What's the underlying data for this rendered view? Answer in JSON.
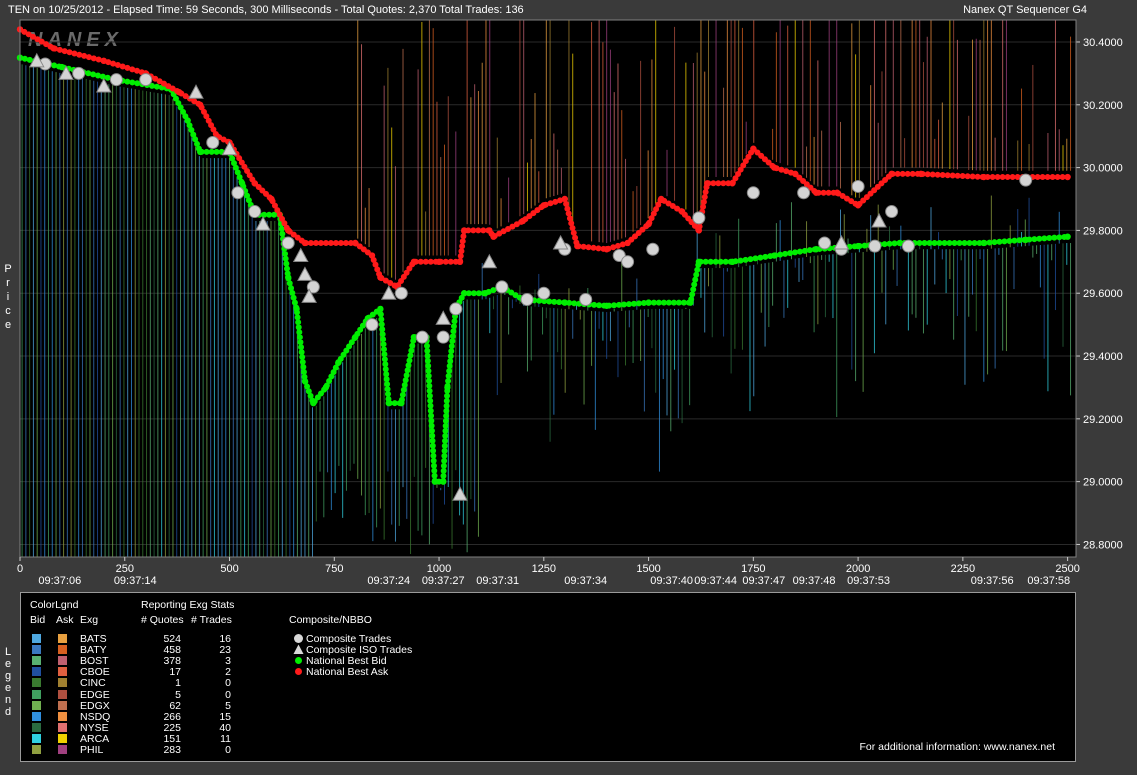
{
  "header": {
    "info": "TEN on 10/25/2012  -  Elapsed Time: 59 Seconds, 300 Milliseconds  -  Total Quotes: 2,370  Total Trades: 136",
    "app": "Nanex QT Sequencer G4",
    "watermark": "NANEX"
  },
  "axis_titles": {
    "price": "Price",
    "legend": "Legend"
  },
  "chart_data": {
    "type": "line",
    "ylabel": "Price",
    "ylim": [
      28.76,
      30.47
    ],
    "xlim": [
      0,
      2520
    ],
    "y_ticks": [
      "30.4000",
      "30.2000",
      "30.0000",
      "29.8000",
      "29.6000",
      "29.4000",
      "29.2000",
      "29.0000",
      "28.8000"
    ],
    "y_tick_values": [
      30.4,
      30.2,
      30.0,
      29.8,
      29.6,
      29.4,
      29.2,
      29.0,
      28.8
    ],
    "x_ticks": [
      {
        "label": "0",
        "value": 0
      },
      {
        "label": "250",
        "value": 250
      },
      {
        "label": "500",
        "value": 500
      },
      {
        "label": "750",
        "value": 750
      },
      {
        "label": "1000",
        "value": 1000
      },
      {
        "label": "1250",
        "value": 1250
      },
      {
        "label": "1500",
        "value": 1500
      },
      {
        "label": "1750",
        "value": 1750
      },
      {
        "label": "2000",
        "value": 2000
      },
      {
        "label": "2250",
        "value": 2250
      },
      {
        "label": "2500",
        "value": 2500
      }
    ],
    "time_labels": [
      {
        "label": "09:37:06",
        "value": 95
      },
      {
        "label": "09:37:14",
        "value": 275
      },
      {
        "label": "09:37:24",
        "value": 880
      },
      {
        "label": "09:37:27",
        "value": 1010
      },
      {
        "label": "09:37:31",
        "value": 1140
      },
      {
        "label": "09:37:34",
        "value": 1350
      },
      {
        "label": "09:37:40",
        "value": 1555
      },
      {
        "label": "09:37:44",
        "value": 1660
      },
      {
        "label": "09:37:47",
        "value": 1775
      },
      {
        "label": "09:37:48",
        "value": 1895
      },
      {
        "label": "09:37:53",
        "value": 2025
      },
      {
        "label": "09:37:56",
        "value": 2320
      },
      {
        "label": "09:37:58",
        "value": 2455
      }
    ],
    "series": [
      {
        "name": "National Best Bid",
        "color": "#00ee00",
        "points": [
          [
            0,
            30.35
          ],
          [
            100,
            30.32
          ],
          [
            230,
            30.28
          ],
          [
            360,
            30.25
          ],
          [
            400,
            30.15
          ],
          [
            430,
            30.05
          ],
          [
            500,
            30.05
          ],
          [
            530,
            29.95
          ],
          [
            560,
            29.85
          ],
          [
            620,
            29.85
          ],
          [
            640,
            29.65
          ],
          [
            660,
            29.55
          ],
          [
            680,
            29.32
          ],
          [
            700,
            29.25
          ],
          [
            730,
            29.3
          ],
          [
            760,
            29.38
          ],
          [
            800,
            29.46
          ],
          [
            830,
            29.52
          ],
          [
            860,
            29.55
          ],
          [
            880,
            29.25
          ],
          [
            910,
            29.25
          ],
          [
            940,
            29.46
          ],
          [
            970,
            29.46
          ],
          [
            990,
            29.0
          ],
          [
            1010,
            29.0
          ],
          [
            1020,
            29.3
          ],
          [
            1040,
            29.55
          ],
          [
            1060,
            29.6
          ],
          [
            1110,
            29.6
          ],
          [
            1150,
            29.62
          ],
          [
            1200,
            29.58
          ],
          [
            1300,
            29.57
          ],
          [
            1400,
            29.56
          ],
          [
            1500,
            29.57
          ],
          [
            1600,
            29.57
          ],
          [
            1620,
            29.7
          ],
          [
            1700,
            29.7
          ],
          [
            1800,
            29.72
          ],
          [
            1900,
            29.74
          ],
          [
            2000,
            29.75
          ],
          [
            2100,
            29.76
          ],
          [
            2300,
            29.76
          ],
          [
            2400,
            29.77
          ],
          [
            2500,
            29.78
          ]
        ]
      },
      {
        "name": "National Best Ask",
        "color": "#ff1a1a",
        "points": [
          [
            0,
            30.44
          ],
          [
            80,
            30.38
          ],
          [
            200,
            30.34
          ],
          [
            300,
            30.3
          ],
          [
            380,
            30.24
          ],
          [
            430,
            30.2
          ],
          [
            470,
            30.1
          ],
          [
            500,
            30.08
          ],
          [
            560,
            29.95
          ],
          [
            600,
            29.9
          ],
          [
            640,
            29.8
          ],
          [
            680,
            29.76
          ],
          [
            800,
            29.76
          ],
          [
            840,
            29.72
          ],
          [
            860,
            29.65
          ],
          [
            900,
            29.62
          ],
          [
            940,
            29.7
          ],
          [
            1000,
            29.7
          ],
          [
            1050,
            29.7
          ],
          [
            1060,
            29.8
          ],
          [
            1120,
            29.8
          ],
          [
            1130,
            29.78
          ],
          [
            1200,
            29.83
          ],
          [
            1250,
            29.88
          ],
          [
            1300,
            29.9
          ],
          [
            1330,
            29.75
          ],
          [
            1400,
            29.74
          ],
          [
            1450,
            29.76
          ],
          [
            1500,
            29.82
          ],
          [
            1530,
            29.9
          ],
          [
            1580,
            29.86
          ],
          [
            1620,
            29.8
          ],
          [
            1640,
            29.95
          ],
          [
            1700,
            29.95
          ],
          [
            1750,
            30.06
          ],
          [
            1800,
            30.0
          ],
          [
            1850,
            29.98
          ],
          [
            1900,
            29.92
          ],
          [
            1950,
            29.92
          ],
          [
            2000,
            29.88
          ],
          [
            2080,
            29.98
          ],
          [
            2150,
            29.98
          ],
          [
            2300,
            29.97
          ],
          [
            2400,
            29.97
          ],
          [
            2500,
            29.97
          ]
        ]
      }
    ],
    "trades": [
      [
        60,
        30.33
      ],
      [
        140,
        30.3
      ],
      [
        230,
        30.28
      ],
      [
        300,
        30.28
      ],
      [
        460,
        30.08
      ],
      [
        520,
        29.92
      ],
      [
        560,
        29.86
      ],
      [
        640,
        29.76
      ],
      [
        700,
        29.62
      ],
      [
        840,
        29.5
      ],
      [
        910,
        29.6
      ],
      [
        960,
        29.46
      ],
      [
        1010,
        29.46
      ],
      [
        1040,
        29.55
      ],
      [
        1150,
        29.62
      ],
      [
        1210,
        29.58
      ],
      [
        1250,
        29.6
      ],
      [
        1300,
        29.74
      ],
      [
        1350,
        29.58
      ],
      [
        1430,
        29.72
      ],
      [
        1450,
        29.7
      ],
      [
        1510,
        29.74
      ],
      [
        1620,
        29.84
      ],
      [
        1750,
        29.92
      ],
      [
        1870,
        29.92
      ],
      [
        1920,
        29.76
      ],
      [
        1960,
        29.74
      ],
      [
        2000,
        29.94
      ],
      [
        2040,
        29.75
      ],
      [
        2080,
        29.86
      ],
      [
        2120,
        29.75
      ],
      [
        2400,
        29.96
      ]
    ],
    "iso_trades": [
      [
        40,
        30.34
      ],
      [
        110,
        30.3
      ],
      [
        200,
        30.26
      ],
      [
        420,
        30.24
      ],
      [
        500,
        30.06
      ],
      [
        580,
        29.82
      ],
      [
        670,
        29.72
      ],
      [
        680,
        29.66
      ],
      [
        690,
        29.59
      ],
      [
        880,
        29.6
      ],
      [
        1010,
        29.52
      ],
      [
        1050,
        28.96
      ],
      [
        1120,
        29.7
      ],
      [
        1290,
        29.76
      ],
      [
        1960,
        29.76
      ],
      [
        2050,
        29.83
      ]
    ],
    "legend": {
      "title_color": "ColorLgnd",
      "title_stats": "Reporting Exg Stats",
      "title_comp": "Composite/NBBO",
      "col_bid": "Bid",
      "col_ask": "Ask",
      "col_exg": "Exg",
      "col_quotes": "# Quotes",
      "col_trades": "# Trades",
      "rows": [
        {
          "exg": "BATS",
          "quotes": "524",
          "trades": "16",
          "bid": "#4fa8e0",
          "ask": "#e8a040"
        },
        {
          "exg": "BATY",
          "quotes": "458",
          "trades": "23",
          "bid": "#3a78c0",
          "ask": "#d86020"
        },
        {
          "exg": "BOST",
          "quotes": "378",
          "trades": "3",
          "bid": "#58b070",
          "ask": "#c06070"
        },
        {
          "exg": "CBOE",
          "quotes": "17",
          "trades": "2",
          "bid": "#2050a0",
          "ask": "#e06040"
        },
        {
          "exg": "CINC",
          "quotes": "1",
          "trades": "0",
          "bid": "#3a7a30",
          "ask": "#a08030"
        },
        {
          "exg": "EDGE",
          "quotes": "5",
          "trades": "0",
          "bid": "#40a060",
          "ask": "#b05040"
        },
        {
          "exg": "EDGX",
          "quotes": "62",
          "trades": "5",
          "bid": "#70b050",
          "ask": "#c07050"
        },
        {
          "exg": "NSDQ",
          "quotes": "266",
          "trades": "15",
          "bid": "#3090e0",
          "ask": "#f09040"
        },
        {
          "exg": "NYSE",
          "quotes": "225",
          "trades": "40",
          "bid": "#2a6a40",
          "ask": "#e07070"
        },
        {
          "exg": "ARCA",
          "quotes": "151",
          "trades": "11",
          "bid": "#30d0e0",
          "ask": "#f0d000"
        },
        {
          "exg": "PHIL",
          "quotes": "283",
          "trades": "0",
          "bid": "#90a040",
          "ask": "#a04080"
        }
      ],
      "composite": [
        {
          "label": "Composite Trades",
          "shape": "circle",
          "color": "#d8d8d8"
        },
        {
          "label": "Composite ISO Trades",
          "shape": "triangle",
          "color": "#d8d8d8"
        },
        {
          "label": "National Best Bid",
          "shape": "dot",
          "color": "#00ee00"
        },
        {
          "label": "National Best Ask",
          "shape": "dot",
          "color": "#ff1a1a"
        }
      ],
      "footer": "For additional information: www.nanex.net"
    }
  }
}
